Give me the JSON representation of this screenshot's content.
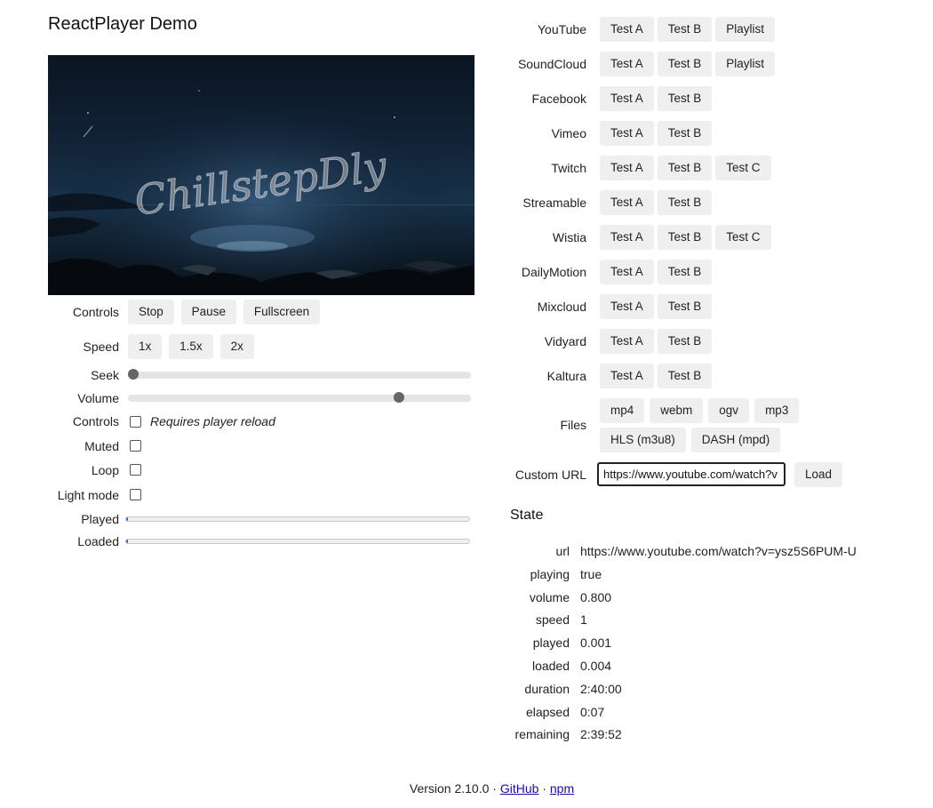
{
  "app": {
    "title": "ReactPlayer Demo"
  },
  "player": {
    "watermark": "ChillstepDly"
  },
  "left": {
    "controls_label": "Controls",
    "controls_buttons": [
      "Stop",
      "Pause",
      "Fullscreen"
    ],
    "speed_label": "Speed",
    "speed_buttons": [
      "1x",
      "1.5x",
      "2x"
    ],
    "seek_label": "Seek",
    "seek_value": 0.001,
    "volume_label": "Volume",
    "volume_value": 0.8,
    "controls_checkbox_label": "Controls",
    "controls_checkbox_note": "Requires player reload",
    "muted_label": "Muted",
    "loop_label": "Loop",
    "light_mode_label": "Light mode",
    "played_label": "Played",
    "played_value": 0.001,
    "loaded_label": "Loaded",
    "loaded_value": 0.004
  },
  "sources": [
    {
      "name": "YouTube",
      "buttons": [
        "Test A",
        "Test B",
        "Playlist"
      ]
    },
    {
      "name": "SoundCloud",
      "buttons": [
        "Test A",
        "Test B",
        "Playlist"
      ]
    },
    {
      "name": "Facebook",
      "buttons": [
        "Test A",
        "Test B"
      ]
    },
    {
      "name": "Vimeo",
      "buttons": [
        "Test A",
        "Test B"
      ]
    },
    {
      "name": "Twitch",
      "buttons": [
        "Test A",
        "Test B",
        "Test C"
      ]
    },
    {
      "name": "Streamable",
      "buttons": [
        "Test A",
        "Test B"
      ]
    },
    {
      "name": "Wistia",
      "buttons": [
        "Test A",
        "Test B",
        "Test C"
      ]
    },
    {
      "name": "DailyMotion",
      "buttons": [
        "Test A",
        "Test B"
      ]
    },
    {
      "name": "Mixcloud",
      "buttons": [
        "Test A",
        "Test B"
      ]
    },
    {
      "name": "Vidyard",
      "buttons": [
        "Test A",
        "Test B"
      ]
    },
    {
      "name": "Kaltura",
      "buttons": [
        "Test A",
        "Test B"
      ]
    }
  ],
  "files": {
    "label": "Files",
    "buttons": [
      "mp4",
      "webm",
      "ogv",
      "mp3",
      "HLS (m3u8)",
      "DASH (mpd)"
    ]
  },
  "custom_url": {
    "label": "Custom URL",
    "value": "https://www.youtube.com/watch?v",
    "load_label": "Load"
  },
  "state": {
    "heading": "State",
    "rows": [
      {
        "key": "url",
        "value": "https://www.youtube.com/watch?v=ysz5S6PUM-U"
      },
      {
        "key": "playing",
        "value": "true"
      },
      {
        "key": "volume",
        "value": "0.800"
      },
      {
        "key": "speed",
        "value": "1"
      },
      {
        "key": "played",
        "value": "0.001"
      },
      {
        "key": "loaded",
        "value": "0.004"
      },
      {
        "key": "duration",
        "value": "2:40:00"
      },
      {
        "key": "elapsed",
        "value": "0:07"
      },
      {
        "key": "remaining",
        "value": "2:39:52"
      }
    ]
  },
  "footer": {
    "version": "Version 2.10.0",
    "sep": "·",
    "github": "GitHub",
    "npm": "npm"
  }
}
